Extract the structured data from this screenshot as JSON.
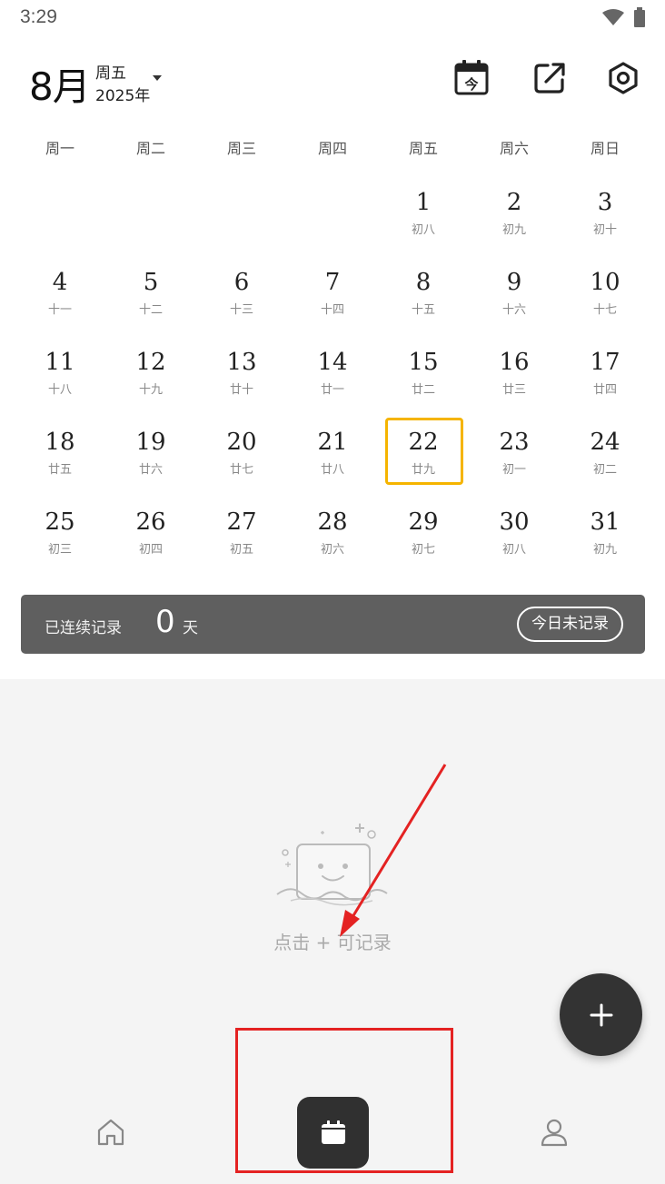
{
  "status_bar": {
    "time": "3:29"
  },
  "header": {
    "month": "8月",
    "weekday": "周五",
    "year": "2025年",
    "today_icon_char": "今"
  },
  "weekdays": [
    "周一",
    "周二",
    "周三",
    "周四",
    "周五",
    "周六",
    "周日"
  ],
  "calendar": {
    "today": 22,
    "first_weekday_index": 4,
    "days": [
      {
        "day": "1",
        "lunar": "初八"
      },
      {
        "day": "2",
        "lunar": "初九"
      },
      {
        "day": "3",
        "lunar": "初十"
      },
      {
        "day": "4",
        "lunar": "十一"
      },
      {
        "day": "5",
        "lunar": "十二"
      },
      {
        "day": "6",
        "lunar": "十三"
      },
      {
        "day": "7",
        "lunar": "十四"
      },
      {
        "day": "8",
        "lunar": "十五"
      },
      {
        "day": "9",
        "lunar": "十六"
      },
      {
        "day": "10",
        "lunar": "十七"
      },
      {
        "day": "11",
        "lunar": "十八"
      },
      {
        "day": "12",
        "lunar": "十九"
      },
      {
        "day": "13",
        "lunar": "廿十"
      },
      {
        "day": "14",
        "lunar": "廿一"
      },
      {
        "day": "15",
        "lunar": "廿二"
      },
      {
        "day": "16",
        "lunar": "廿三"
      },
      {
        "day": "17",
        "lunar": "廿四"
      },
      {
        "day": "18",
        "lunar": "廿五"
      },
      {
        "day": "19",
        "lunar": "廿六"
      },
      {
        "day": "20",
        "lunar": "廿七"
      },
      {
        "day": "21",
        "lunar": "廿八"
      },
      {
        "day": "22",
        "lunar": "廿九"
      },
      {
        "day": "23",
        "lunar": "初一"
      },
      {
        "day": "24",
        "lunar": "初二"
      },
      {
        "day": "25",
        "lunar": "初三"
      },
      {
        "day": "26",
        "lunar": "初四"
      },
      {
        "day": "27",
        "lunar": "初五"
      },
      {
        "day": "28",
        "lunar": "初六"
      },
      {
        "day": "29",
        "lunar": "初七"
      },
      {
        "day": "30",
        "lunar": "初八"
      },
      {
        "day": "31",
        "lunar": "初九"
      }
    ]
  },
  "streak": {
    "label": "已连续记录",
    "count": "0",
    "unit": "天",
    "today_status": "今日未记录"
  },
  "empty_state": {
    "text": "点击 + 可记录"
  },
  "colors": {
    "today_highlight": "#f5b400",
    "dark": "#333333",
    "annotation": "#e42222"
  },
  "icons": [
    "calendar-today-icon",
    "share-icon",
    "settings-icon",
    "plus-icon",
    "home-icon",
    "calendar-icon",
    "user-icon"
  ]
}
